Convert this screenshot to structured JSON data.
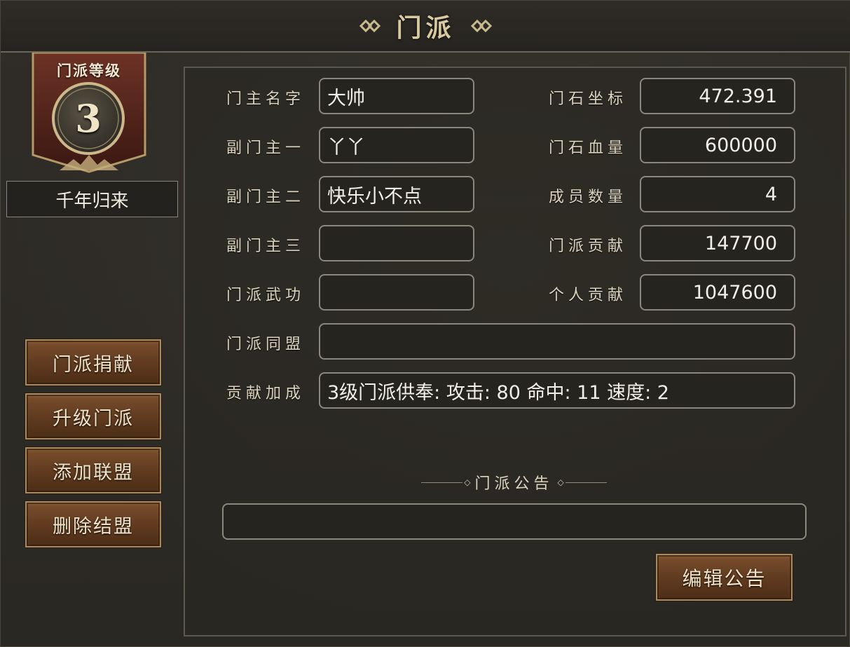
{
  "window": {
    "title": "门派"
  },
  "level_badge": {
    "label": "门派等级",
    "level": "3"
  },
  "guild_name": "千年归来",
  "side_buttons": [
    "门派捐献",
    "升级门派",
    "添加联盟",
    "删除结盟"
  ],
  "fields": {
    "leader": {
      "label": "门主名字",
      "value": "大帅"
    },
    "vice1": {
      "label": "副门主一",
      "value": "丫丫"
    },
    "vice2": {
      "label": "副门主二",
      "value": "快乐小不点"
    },
    "vice3": {
      "label": "副门主三",
      "value": ""
    },
    "skill": {
      "label": "门派武功",
      "value": ""
    },
    "alliance": {
      "label": "门派同盟",
      "value": ""
    },
    "bonus": {
      "label": "贡献加成",
      "value": "3级门派供奉: 攻击: 80 命中: 11 速度: 2"
    },
    "stone_coord": {
      "label": "门石坐标",
      "value": "472.391"
    },
    "stone_hp": {
      "label": "门石血量",
      "value": "600000"
    },
    "members": {
      "label": "成员数量",
      "value": "4"
    },
    "guild_contrib": {
      "label": "门派贡献",
      "value": "147700"
    },
    "personal_contrib": {
      "label": "个人贡献",
      "value": "1047600"
    }
  },
  "notice": {
    "title": "门派公告",
    "value": "",
    "edit_label": "编辑公告"
  },
  "colors": {
    "accent": "#d9c9a0",
    "button": "#6a4325",
    "panel": "#2b2924"
  }
}
